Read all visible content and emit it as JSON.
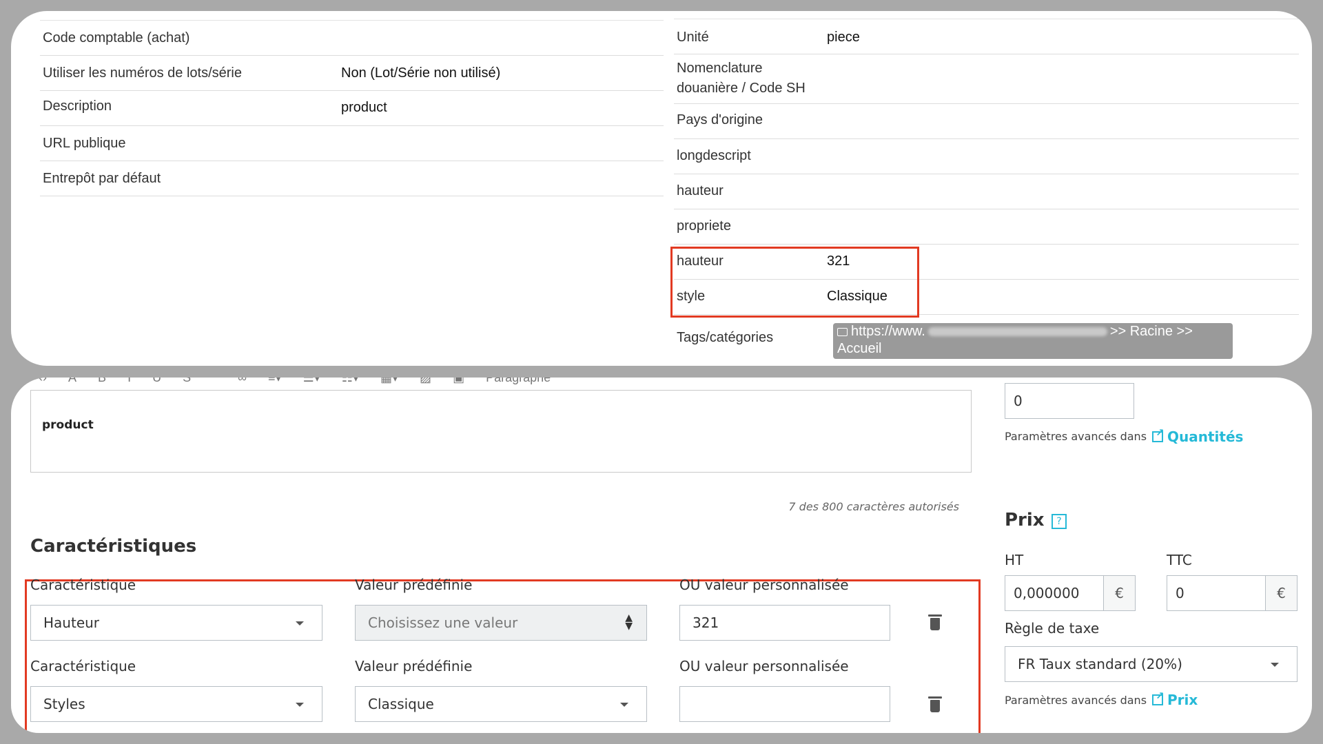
{
  "product_info": {
    "left_rows": [
      {
        "label": "Code comptable (achat)",
        "value": ""
      },
      {
        "label": "Utiliser les numéros de lots/série",
        "value": "Non (Lot/Série non utilisé)"
      },
      {
        "label": "Description",
        "value": "product"
      },
      {
        "label": "URL publique",
        "value": ""
      },
      {
        "label": "Entrepôt par défaut",
        "value": ""
      }
    ],
    "right_rows": [
      {
        "label": "Unité",
        "value": "piece"
      },
      {
        "label": "Nomenclature douanière / Code SH",
        "value": ""
      },
      {
        "label": "Pays d'origine",
        "value": ""
      },
      {
        "label": "longdescript",
        "value": ""
      },
      {
        "label": "hauteur",
        "value": ""
      },
      {
        "label": "propriete",
        "value": ""
      },
      {
        "label": "hauteur",
        "value": "321"
      },
      {
        "label": "style",
        "value": "Classique"
      }
    ],
    "tags_label": "Tags/catégories",
    "tag_chip": {
      "prefix": "https://www.",
      "suffix": ">> Racine >>",
      "line2": "Accueil"
    }
  },
  "editor": {
    "toolbar_icons": [
      "code-icon",
      "text-color-icon",
      "bold-icon",
      "italic-icon",
      "underline-icon",
      "strike-icon",
      "quote-icon",
      "link-icon",
      "align-icon",
      "bullet-list-icon",
      "numbered-list-icon",
      "table-icon",
      "image-icon",
      "media-icon"
    ],
    "toolbar_format": "Paragraphe",
    "content": "product",
    "char_count": "7 des 800 caractères autorisés"
  },
  "features": {
    "title": "Caractéristiques",
    "rows": [
      {
        "feature_label": "Caractéristique",
        "feature_value": "Hauteur",
        "predefined_label": "Valeur prédéfinie",
        "predefined_value": "Choisissez une valeur",
        "predefined_disabled": true,
        "custom_label": "OU valeur personnalisée",
        "custom_value": "321"
      },
      {
        "feature_label": "Caractéristique",
        "feature_value": "Styles",
        "predefined_label": "Valeur prédéfinie",
        "predefined_value": "Classique",
        "predefined_disabled": false,
        "custom_label": "OU valeur personnalisée",
        "custom_value": ""
      }
    ]
  },
  "quantity": {
    "value": "0",
    "advanced_text": "Paramètres avancés dans",
    "advanced_link": "Quantités"
  },
  "price": {
    "title": "Prix",
    "ht_label": "HT",
    "ht_value": "0,000000",
    "ttc_label": "TTC",
    "ttc_value": "0",
    "currency": "€",
    "tax_label": "Règle de taxe",
    "tax_value": "FR Taux standard (20%)",
    "advanced_text": "Paramètres avancés dans",
    "advanced_link": "Prix"
  },
  "colors": {
    "highlight": "#e23a22",
    "accent": "#25b9d7",
    "tag_chip": "#9a9a9a"
  }
}
